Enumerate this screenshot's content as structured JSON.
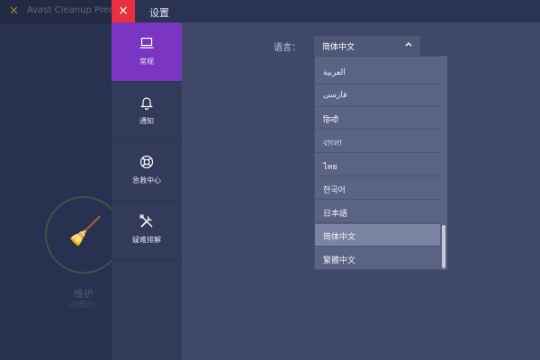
{
  "background_app": {
    "title": "Avast Cleanup Premiu",
    "primary_label": "维护",
    "secondary_label": "(问题计)"
  },
  "settings": {
    "close_symbol": "×",
    "title": "设置",
    "nav": [
      {
        "label": "常规",
        "icon": "laptop-icon",
        "active": true
      },
      {
        "label": "通知",
        "icon": "bell-icon",
        "active": false
      },
      {
        "label": "急救中心",
        "icon": "lifebuoy-icon",
        "active": false
      },
      {
        "label": "疑难排解",
        "icon": "tools-icon",
        "active": false
      }
    ],
    "language": {
      "label": "语言：",
      "selected": "简体中文",
      "options": [
        "العربية",
        "فارسی",
        "हिन्दी",
        "বাংলা",
        "ไทย",
        "한국어",
        "日本語",
        "简体中文",
        "繁體中文"
      ],
      "selected_index": 7
    }
  },
  "colors": {
    "close_button": "#e8303e",
    "active_nav": "#7a35c2",
    "nav_bg": "#323b59",
    "content_bg": "#3f4868",
    "dropdown_bg": "#5a6384",
    "dropdown_selected": "#7a83a1"
  }
}
